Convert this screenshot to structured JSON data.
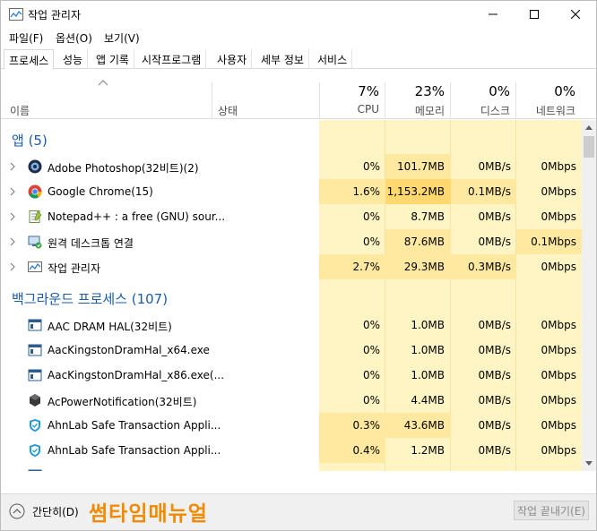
{
  "window": {
    "title": "작업 관리자",
    "controls": {
      "minimize": "minimize-icon",
      "maximize": "maximize-icon",
      "close": "close-icon"
    }
  },
  "menu": [
    "파일(F)",
    "옵션(O)",
    "보기(V)"
  ],
  "tabs": [
    "프로세스",
    "성능",
    "앱 기록",
    "시작프로그램",
    "사용자",
    "세부 정보",
    "서비스"
  ],
  "active_tab": "프로세스",
  "header": {
    "name": "이름",
    "status": "상태",
    "cpu": {
      "pct": "7%",
      "label": "CPU"
    },
    "memory": {
      "pct": "23%",
      "label": "메모리"
    },
    "disk": {
      "pct": "0%",
      "label": "디스크"
    },
    "network": {
      "pct": "0%",
      "label": "네트워크"
    }
  },
  "groups": {
    "apps": {
      "title": "앱 (5)"
    },
    "background": {
      "title": "백그라운드 프로세스 (107)"
    }
  },
  "apps": [
    {
      "name": "Adobe Photoshop(32비트)(2)",
      "icon": "photoshop-icon",
      "cpu": "0%",
      "mem": "101.7MB",
      "disk": "0MB/s",
      "net": "0Mbps"
    },
    {
      "name": "Google Chrome(15)",
      "icon": "chrome-icon",
      "cpu": "1.6%",
      "mem": "1,153.2MB",
      "disk": "0.1MB/s",
      "net": "0Mbps"
    },
    {
      "name": "Notepad++ : a free (GNU) sour...",
      "icon": "notepad-icon",
      "cpu": "0%",
      "mem": "8.7MB",
      "disk": "0MB/s",
      "net": "0Mbps"
    },
    {
      "name": "원격 데스크톱 연결",
      "icon": "remote-desktop-icon",
      "cpu": "0%",
      "mem": "87.6MB",
      "disk": "0MB/s",
      "net": "0.1Mbps"
    },
    {
      "name": "작업 관리자",
      "icon": "task-manager-icon",
      "cpu": "2.7%",
      "mem": "29.3MB",
      "disk": "0.3MB/s",
      "net": "0Mbps"
    }
  ],
  "background": [
    {
      "name": "AAC DRAM HAL(32비트)",
      "icon": "window-app-icon",
      "cpu": "0%",
      "mem": "1.0MB",
      "disk": "0MB/s",
      "net": "0Mbps"
    },
    {
      "name": "AacKingstonDramHal_x64.exe",
      "icon": "window-app-icon",
      "cpu": "0%",
      "mem": "1.0MB",
      "disk": "0MB/s",
      "net": "0Mbps"
    },
    {
      "name": "AacKingstonDramHal_x86.exe(...",
      "icon": "window-app-icon",
      "cpu": "0%",
      "mem": "1.0MB",
      "disk": "0MB/s",
      "net": "0Mbps"
    },
    {
      "name": "AcPowerNotification(32비트)",
      "icon": "cube-icon",
      "cpu": "0%",
      "mem": "4.4MB",
      "disk": "0MB/s",
      "net": "0Mbps"
    },
    {
      "name": "AhnLab Safe Transaction Appli...",
      "icon": "shield-icon",
      "cpu": "0.3%",
      "mem": "43.6MB",
      "disk": "0MB/s",
      "net": "0Mbps"
    },
    {
      "name": "AhnLab Safe Transaction Appli...",
      "icon": "shield-icon",
      "cpu": "0.4%",
      "mem": "1.2MB",
      "disk": "0MB/s",
      "net": "0Mbps"
    }
  ],
  "footer": {
    "collapse_label": "간단히(D)",
    "watermark": "썸타임매뉴얼",
    "end_task": "작업 끝내기(E)"
  },
  "colors": {
    "heat_light": "#fff4c4",
    "heat_medium": "#ffe9a0",
    "group_blue": "#1a5ba7",
    "watermark_orange": "#f08a00"
  }
}
